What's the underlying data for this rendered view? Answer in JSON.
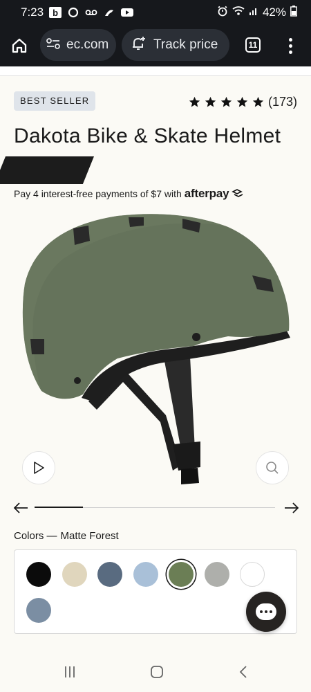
{
  "status_bar": {
    "time": "7:23",
    "battery": "42%",
    "notification_icons": [
      "b-icon",
      "circle-icon",
      "voicemail-icon",
      "surf-icon",
      "youtube-icon"
    ]
  },
  "browser": {
    "url": "ec.com",
    "track_price_label": "Track price",
    "tab_count": "11"
  },
  "product": {
    "badge": "BEST SELLER",
    "rating_stars": 5,
    "review_count": "(173)",
    "title": "Dakota Bike & Skate Helmet",
    "afterpay_text": "Pay 4 interest-free payments of $7 with",
    "afterpay_logo": "afterpay"
  },
  "gallery": {
    "progress": 0.2
  },
  "colors": {
    "label": "Colors —",
    "selected_name": "Matte Forest",
    "swatches": [
      {
        "color": "#0b0b0b",
        "selected": false
      },
      {
        "color": "#e0d6bd",
        "selected": false
      },
      {
        "color": "#596b80",
        "selected": false
      },
      {
        "color": "#a9c0d8",
        "selected": false
      },
      {
        "color": "#6b7e55",
        "selected": true
      },
      {
        "color": "#aeafab",
        "selected": false
      },
      {
        "color": "#ffffff",
        "selected": false
      },
      {
        "color": "#7b8ea3",
        "selected": false
      }
    ]
  },
  "theme": {
    "helmet_color": "#65735b",
    "accent_dark": "#16181c"
  }
}
